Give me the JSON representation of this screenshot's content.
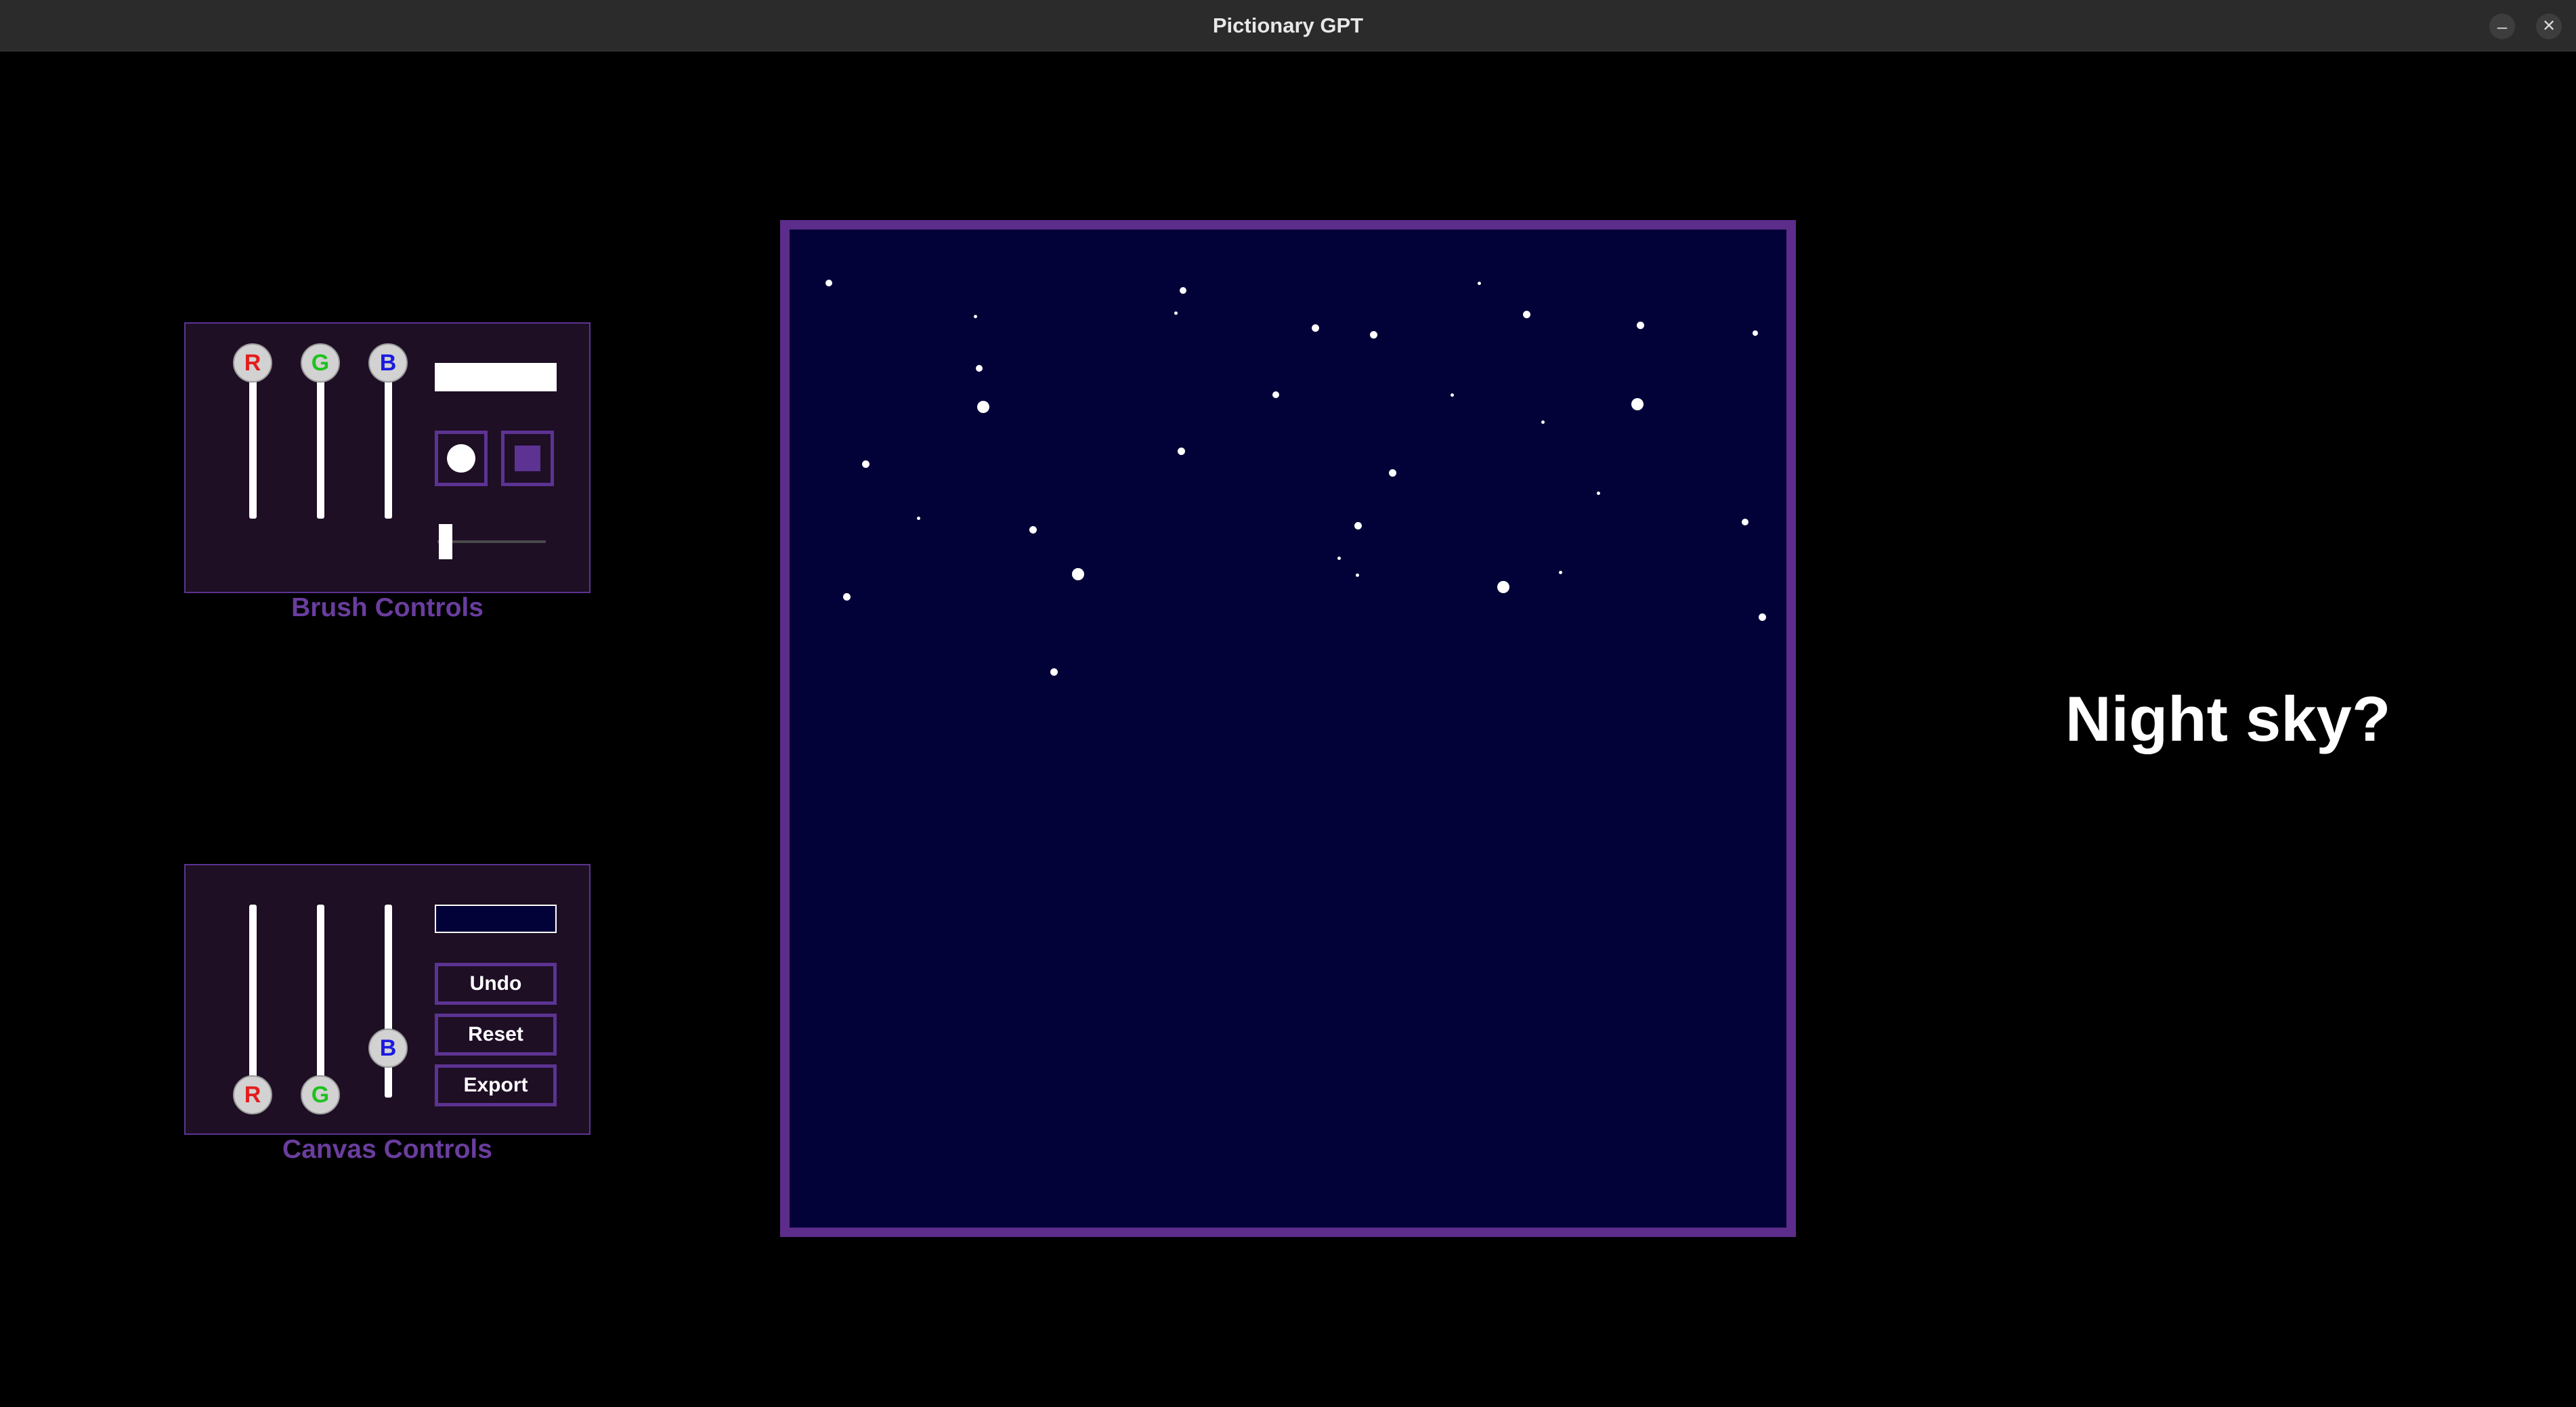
{
  "window": {
    "title": "Pictionary GPT",
    "minimize_glyph": "–",
    "close_glyph": "✕"
  },
  "brush_controls": {
    "label": "Brush Controls",
    "sliders": [
      {
        "letter": "R",
        "letter_color": "#e41c1c",
        "value": 255
      },
      {
        "letter": "G",
        "letter_color": "#1ec21e",
        "value": 255
      },
      {
        "letter": "B",
        "letter_color": "#1a1ae0",
        "value": 255
      }
    ],
    "preview_color": "#ffffff",
    "shapes": [
      {
        "name": "circle-brush",
        "selected": true
      },
      {
        "name": "square-brush",
        "selected": false
      }
    ],
    "size_fraction": 0.05
  },
  "canvas_controls": {
    "label": "Canvas Controls",
    "sliders": [
      {
        "letter": "R",
        "letter_color": "#e41c1c",
        "value": 0
      },
      {
        "letter": "G",
        "letter_color": "#1ec21e",
        "value": 0
      },
      {
        "letter": "B",
        "letter_color": "#1a1ae0",
        "value": 63
      }
    ],
    "preview_color": "#020238",
    "buttons": {
      "undo": "Undo",
      "reset": "Reset",
      "export": "Export"
    }
  },
  "canvas": {
    "background": "#020238",
    "border_color": "#5c2d8a",
    "stars": 32
  },
  "guess": "Night sky?",
  "colors": {
    "accent": "#5c3392",
    "panel_bg": "#1e0f25",
    "label": "#6a3d9e"
  }
}
